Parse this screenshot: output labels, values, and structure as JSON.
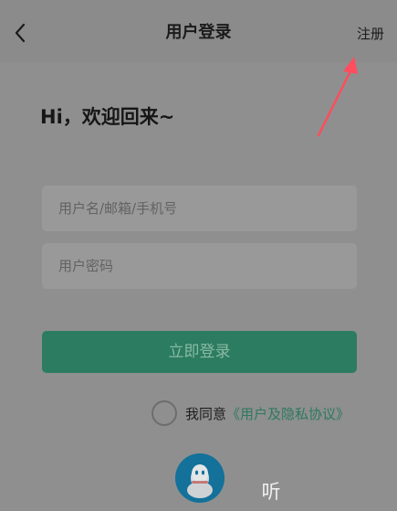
{
  "header": {
    "title": "用户登录",
    "register_label": "注册",
    "back_icon": "chevron-left-icon"
  },
  "welcome": {
    "text": "Hi，欢迎回来~"
  },
  "form": {
    "username_placeholder": "用户名/邮箱/手机号",
    "username_value": "",
    "password_placeholder": "用户密码",
    "password_value": "",
    "login_label": "立即登录"
  },
  "agreement": {
    "checked": false,
    "text": "我同意",
    "link_text": "《用户及隐私协议》"
  },
  "social": {
    "qq_icon": "qq-icon",
    "listen_icon": "listen-icon",
    "listen_glyph": "听"
  },
  "colors": {
    "accent": "#2b7c60",
    "link": "#2c7a5f",
    "qq_blue": "#13719a",
    "annotation_arrow": "#ff4d5e"
  }
}
